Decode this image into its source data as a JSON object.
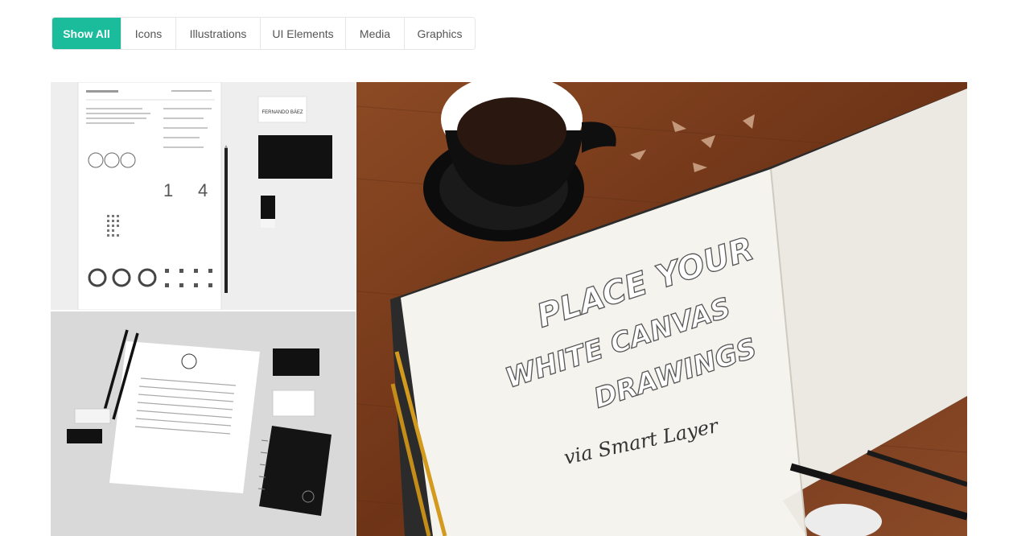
{
  "filters": {
    "items": [
      {
        "label": "Show All",
        "active": true
      },
      {
        "label": "Icons",
        "active": false
      },
      {
        "label": "Illustrations",
        "active": false
      },
      {
        "label": "UI Elements",
        "active": false
      },
      {
        "label": "Media",
        "active": false
      },
      {
        "label": "Graphics",
        "active": false
      }
    ]
  },
  "colors": {
    "accent": "#1abc9c",
    "border": "#e6e6e6",
    "text": "#555555"
  },
  "gallery": {
    "items": [
      {
        "name": "resume-mockup",
        "printed_text": "FERNANDO BÁEZ"
      },
      {
        "name": "stationery-mockup"
      },
      {
        "name": "sketchbook-mockup",
        "printed_text": "PLACE YOUR WHITE CANVAS DRAWINGS via Smart Layer"
      }
    ]
  }
}
